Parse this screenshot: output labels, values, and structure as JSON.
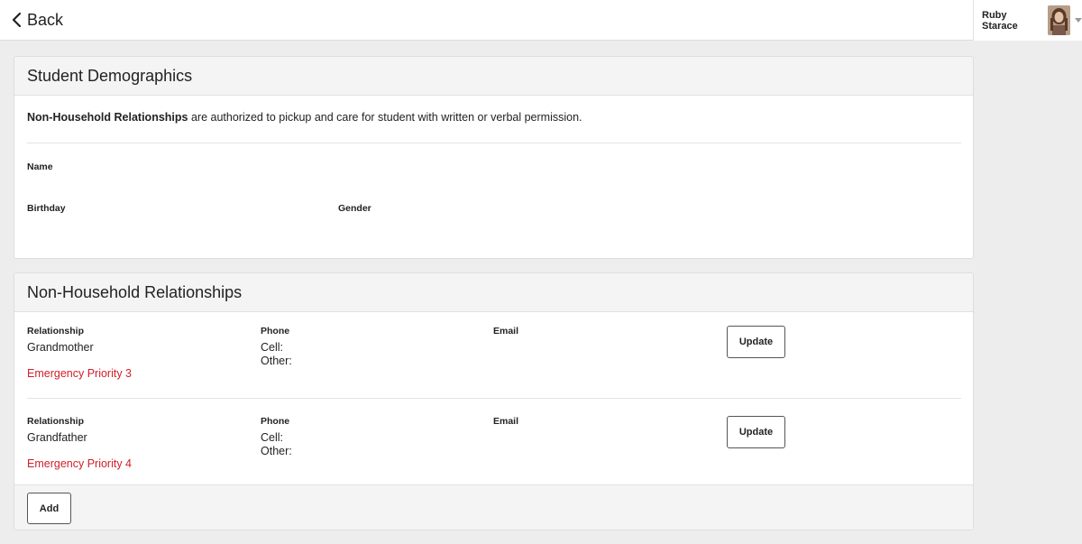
{
  "topbar": {
    "back_label": "Back",
    "user_name": "Ruby Starace"
  },
  "demographics": {
    "title": "Student Demographics",
    "note_bold": "Non-Household Relationships",
    "note_rest": " are authorized to pickup and care for student with written or verbal permission.",
    "name_label": "Name",
    "birthday_label": "Birthday",
    "gender_label": "Gender"
  },
  "relationships": {
    "title": "Non-Household Relationships",
    "relationship_label": "Relationship",
    "phone_label": "Phone",
    "email_label": "Email",
    "cell_label": "Cell:",
    "other_label": "Other:",
    "update_label": "Update",
    "add_label": "Add",
    "items": [
      {
        "relationship": "Grandmother",
        "priority": "Emergency Priority 3"
      },
      {
        "relationship": "Grandfather",
        "priority": "Emergency Priority 4"
      }
    ]
  },
  "colors": {
    "priority": "#d0202a",
    "header_bg": "#f4f4f4",
    "page_bg": "#ededed"
  }
}
